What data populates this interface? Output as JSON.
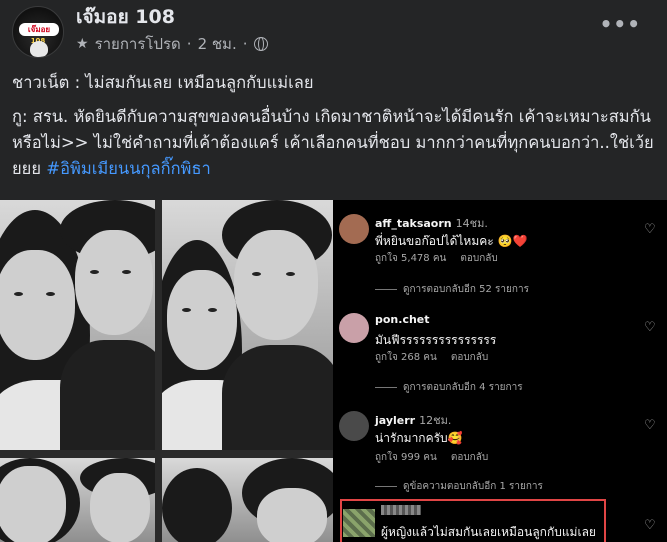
{
  "header": {
    "page_name": "เจ๊มอย 108",
    "avatar_badge": "เจ๊มอย",
    "avatar_sub": "108",
    "meta_favorites": "รายการโปรด",
    "meta_separator": "·",
    "meta_time": "2 ชม.",
    "meta_separator2": "·",
    "more_label": "•••"
  },
  "post": {
    "headline": "ชาวเน็ต :  ไม่สมกันเลย เหมือนลูกกับแม่เลย",
    "body": "กู: สรน. หัดยินดีกับความสุขของคนอื่นบ้าง เกิดมาชาติหน้าจะได้มีคนรัก  เค้าจะเหมาะสมกันหรือไม่>> ไม่ใช่คำถามที่เค้าต้องแคร์ เค้าเลือกคนที่ชอบ มากกว่าคนที่ทุกคนบอกว่า..ใช่เว้ยยยย ",
    "hashtag": "#อิพิมเมียนนกุลกิ๊กพิธา"
  },
  "comments": [
    {
      "user": "aff_taksaorn",
      "time": "14ชม.",
      "text": "พี่หยินขอก๊อปได้ไหมคะ 🥺❤️",
      "likes": "ถูกใจ 5,478 คน",
      "reply": "ตอบกลับ",
      "more_replies": "ดูการตอบกลับอีก 52 รายการ",
      "avatar_color": "#a36b52"
    },
    {
      "user": "pon.chet",
      "time": "",
      "text": "มันฟีรรรรรรรรรรรรรรร",
      "likes": "ถูกใจ 268 คน",
      "reply": "ตอบกลับ",
      "more_replies": "ดูการตอบกลับอีก 4 รายการ",
      "avatar_color": "#c9a0a8"
    },
    {
      "user": "jaylerr",
      "time": "12ชม.",
      "text": "น่ารักมากครับ🥰",
      "likes": "ถูกใจ 999 คน",
      "reply": "ตอบกลับ",
      "more_replies": "ดูข้อความตอบกลับอีก 1 รายการ",
      "avatar_color": "#4a4a4a"
    },
    {
      "user": "",
      "time": "",
      "text": "ผู้หญิงแล้วไม่สมกันเลยเหมือนลูกกับแม่เลย",
      "likes": "",
      "reply": "",
      "more_replies": "",
      "avatar_color": "#6f8a57"
    }
  ],
  "icons": {
    "heart": "♡",
    "star": "★"
  }
}
